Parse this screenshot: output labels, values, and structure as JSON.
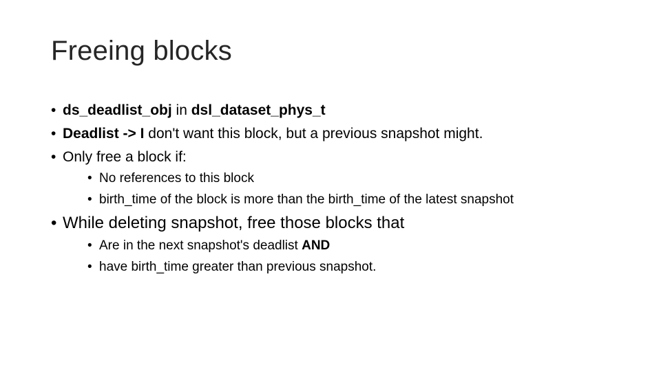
{
  "slide": {
    "title": "Freeing blocks",
    "bullets": [
      {
        "parts": [
          {
            "text": "ds_deadlist_obj",
            "bold": true
          },
          {
            "text": " in ",
            "bold": false
          },
          {
            "text": "dsl_dataset_phys_t",
            "bold": true
          }
        ]
      },
      {
        "parts": [
          {
            "text": "Deadlist -> I",
            "bold": true
          },
          {
            "text": " don't want this block, but a previous snapshot might.",
            "bold": false
          }
        ]
      },
      {
        "parts": [
          {
            "text": "Only free a block if:",
            "bold": false
          }
        ],
        "sub": [
          {
            "parts": [
              {
                "text": "No references to this block",
                "bold": false
              }
            ]
          },
          {
            "parts": [
              {
                "text": "birth_time of the block is more than the birth_time of the latest snapshot",
                "bold": false
              }
            ]
          }
        ]
      },
      {
        "parts": [
          {
            "text": "While deleting snapshot, free those blocks that",
            "bold": false
          }
        ],
        "sub": [
          {
            "parts": [
              {
                "text": "Are in the next snapshot's deadlist ",
                "bold": false
              },
              {
                "text": "AND",
                "bold": true
              }
            ]
          },
          {
            "parts": [
              {
                "text": "have birth_time greater than previous snapshot.",
                "bold": false
              }
            ]
          }
        ]
      }
    ]
  }
}
